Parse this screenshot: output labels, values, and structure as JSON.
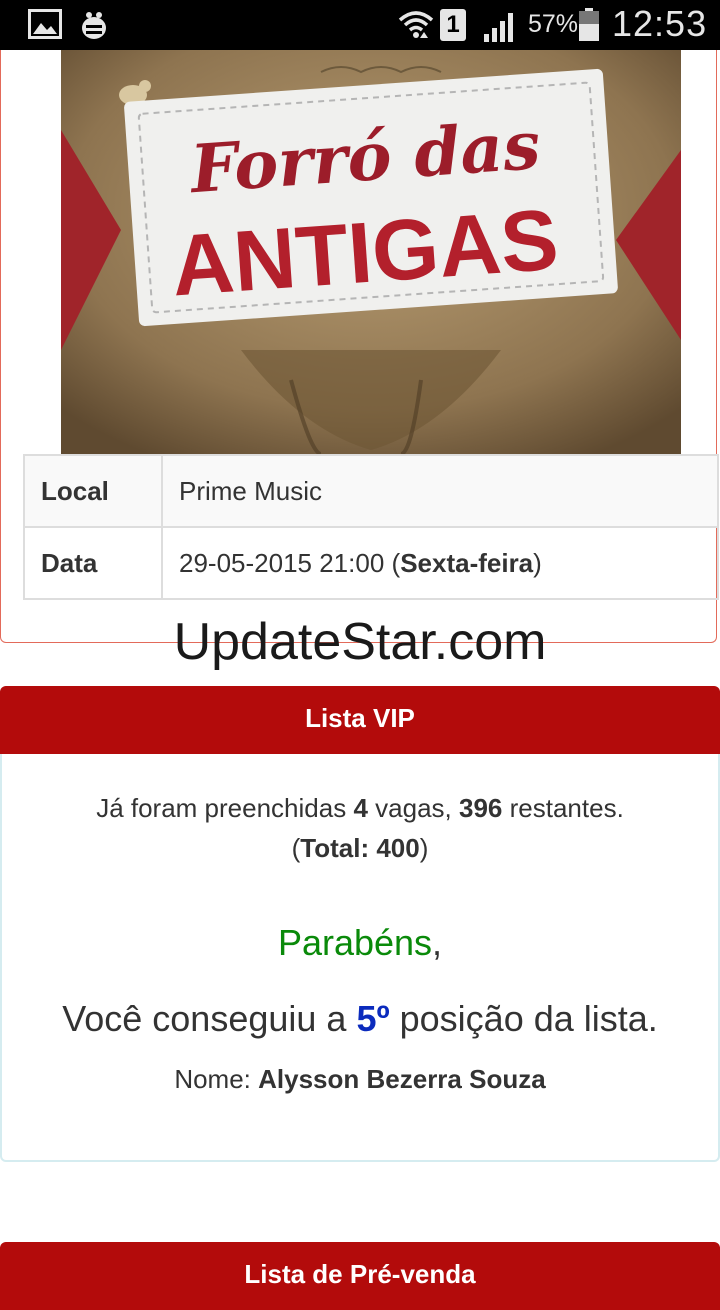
{
  "status_bar": {
    "sim_slot": "1",
    "battery": "57%",
    "time": "12:53"
  },
  "event": {
    "poster_title_line1": "Forró das",
    "poster_title_line2": "ANTIGAS",
    "rows": [
      {
        "key": "Local",
        "value": "Prime Music"
      },
      {
        "key": "Data",
        "date": "29-05-2015 21:00",
        "weekday": "Sexta-feira"
      }
    ]
  },
  "watermark": "UpdateStar.com",
  "vip": {
    "header": "Lista VIP",
    "vacancy_prefix": "Já foram preenchidas",
    "filled": "4",
    "vacancy_mid": "vagas,",
    "remaining": "396",
    "vacancy_suffix": "restantes.",
    "total_label": "Total: 400",
    "congrats": "Parabéns",
    "position_prefix": "Você conseguiu a",
    "position": "5º",
    "position_suffix": "posição da lista.",
    "name_label": "Nome:",
    "name": "Alysson Bezerra Souza"
  },
  "presale": {
    "header": "Lista de Pré-venda"
  },
  "colors": {
    "header_red": "#b30b0b",
    "congrats_green": "#0a8a0a",
    "position_blue": "#0b2bbd"
  }
}
